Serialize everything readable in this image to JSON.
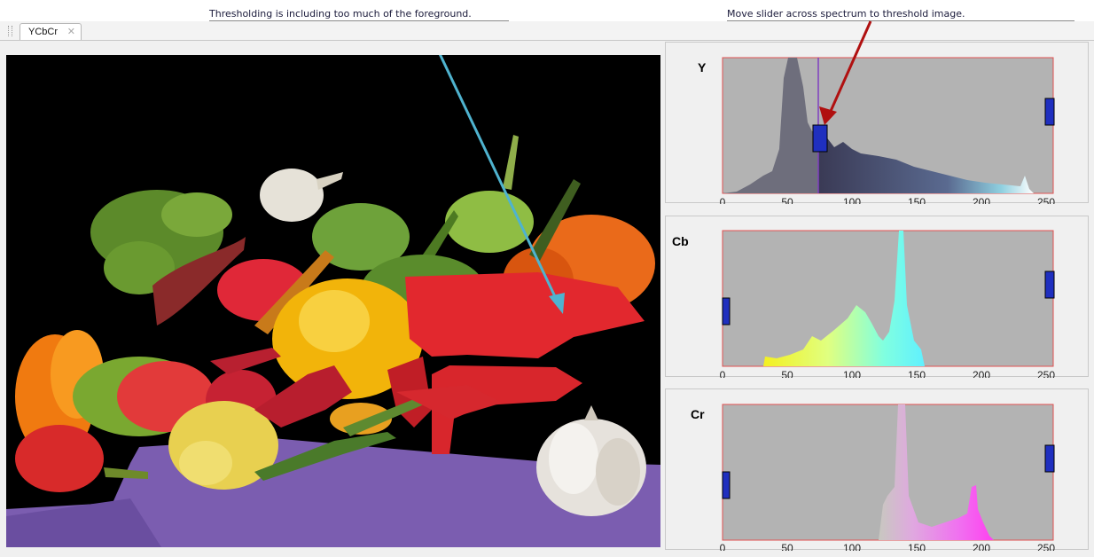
{
  "annotations": {
    "left": "Thresholding is including too much of the foreground.",
    "right": "Move slider across spectrum to threshold image."
  },
  "tab": {
    "label": "YCbCr",
    "close_glyph": "✕"
  },
  "histograms": [
    {
      "label": "Y",
      "ticks": [
        "0",
        "50",
        "100",
        "150",
        "200",
        "250"
      ],
      "lower_threshold": 75,
      "upper_threshold": 255
    },
    {
      "label": "Cb",
      "ticks": [
        "0",
        "50",
        "100",
        "150",
        "200",
        "250"
      ],
      "lower_threshold": 0,
      "upper_threshold": 255
    },
    {
      "label": "Cr",
      "ticks": [
        "0",
        "50",
        "100",
        "150",
        "200",
        "250"
      ],
      "lower_threshold": 0,
      "upper_threshold": 255
    }
  ],
  "colors": {
    "arrow_blue": "#4fb3cf",
    "arrow_red": "#b01010",
    "slider": "#1f2fbf",
    "hist_bg": "#b3b3b3",
    "hist_border": "#e05050"
  }
}
